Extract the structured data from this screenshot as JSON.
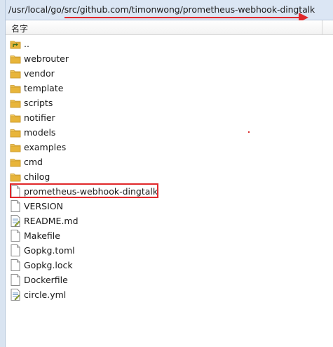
{
  "address_bar": {
    "path": "/usr/local/go/src/github.com/timonwong/prometheus-webhook-dingtalk"
  },
  "column_header": {
    "name_label": "名字"
  },
  "files": [
    {
      "name": "..",
      "icon": "parent-folder-icon"
    },
    {
      "name": "webrouter",
      "icon": "folder-icon"
    },
    {
      "name": "vendor",
      "icon": "folder-icon"
    },
    {
      "name": "template",
      "icon": "folder-icon"
    },
    {
      "name": "scripts",
      "icon": "folder-icon"
    },
    {
      "name": "notifier",
      "icon": "folder-icon"
    },
    {
      "name": "models",
      "icon": "folder-icon"
    },
    {
      "name": "examples",
      "icon": "folder-icon"
    },
    {
      "name": "cmd",
      "icon": "folder-icon"
    },
    {
      "name": "chilog",
      "icon": "folder-icon"
    },
    {
      "name": "prometheus-webhook-dingtalk",
      "icon": "file-icon"
    },
    {
      "name": "VERSION",
      "icon": "file-icon"
    },
    {
      "name": "README.md",
      "icon": "text-document-icon"
    },
    {
      "name": "Makefile",
      "icon": "file-icon"
    },
    {
      "name": "Gopkg.toml",
      "icon": "file-icon"
    },
    {
      "name": "Gopkg.lock",
      "icon": "file-icon"
    },
    {
      "name": "Dockerfile",
      "icon": "file-icon"
    },
    {
      "name": "circle.yml",
      "icon": "text-document-icon"
    }
  ],
  "colors": {
    "annotation_red": "#e0282b",
    "folder_yellow": "#e8b53a",
    "path_bar_bg": "#dbe6f4"
  }
}
